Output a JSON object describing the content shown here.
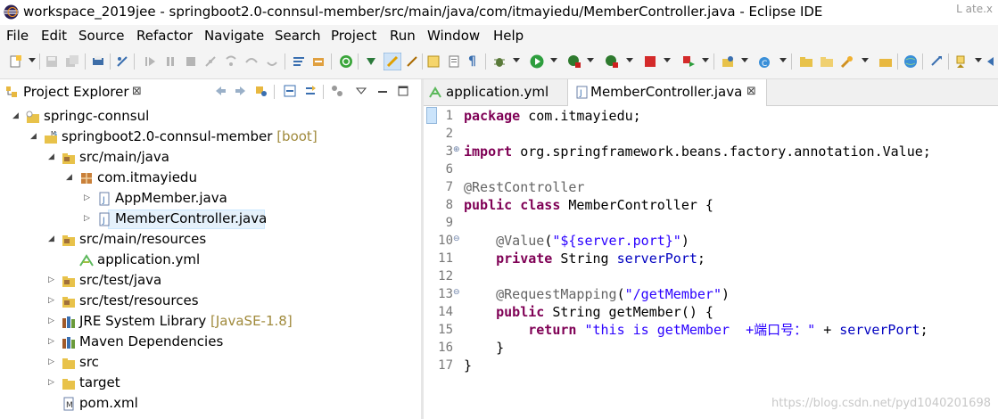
{
  "window": {
    "title": "workspace_2019jee - springboot2.0-connsul-member/src/main/java/com/itmayiedu/MemberController.java - Eclipse IDE",
    "behind_text": "L ate.x"
  },
  "menubar": {
    "items": [
      "File",
      "Edit",
      "Source",
      "Refactor",
      "Navigate",
      "Search",
      "Project",
      "Run",
      "Window",
      "Help"
    ]
  },
  "toolbar": {
    "icons": [
      "new-icon",
      "save-icon",
      "save-all-icon",
      "print-icon",
      "toggle-breakpoint-icon",
      "resume-icon",
      "suspend-icon",
      "terminate-icon",
      "disconnect-icon",
      "step-into-icon",
      "step-over-icon",
      "step-return-icon",
      "drop-to-frame-icon",
      "use-step-filters-icon",
      "spring-icon",
      "open-task-icon",
      "mark-occurrences-icon",
      "toggle-block-icon",
      "toggle-whitespace-icon",
      "skip-breakpoints-icon",
      "debug-icon",
      "run-icon",
      "coverage-icon",
      "external-tools-icon",
      "stop-icon",
      "deploy-icon",
      "new-java-project-icon",
      "new-class-icon",
      "open-type-icon",
      "open-task-icon-2",
      "search-icon",
      "globe-icon",
      "next-annotation-icon",
      "back-icon"
    ]
  },
  "explorer": {
    "title": "Project Explorer",
    "tree": [
      {
        "label": "springc-connsul",
        "decoration": "",
        "icon": "project-icon",
        "twisty": "expanded",
        "depth": 0,
        "selected": false
      },
      {
        "label": "springboot2.0-connsul-member",
        "decoration": " [boot]",
        "icon": "maven-project-icon",
        "twisty": "expanded",
        "depth": 1,
        "selected": false
      },
      {
        "label": "src/main/java",
        "decoration": "",
        "icon": "source-folder-icon",
        "twisty": "expanded",
        "depth": 2,
        "selected": false
      },
      {
        "label": "com.itmayiedu",
        "decoration": "",
        "icon": "package-icon",
        "twisty": "expanded",
        "depth": 3,
        "selected": false
      },
      {
        "label": "AppMember.java",
        "decoration": "",
        "icon": "java-file-icon",
        "twisty": "collapsed",
        "depth": 4,
        "selected": false
      },
      {
        "label": "MemberController.java",
        "decoration": "",
        "icon": "java-file-icon",
        "twisty": "collapsed",
        "depth": 4,
        "selected": true
      },
      {
        "label": "src/main/resources",
        "decoration": "",
        "icon": "source-folder-icon",
        "twisty": "expanded",
        "depth": 2,
        "selected": false
      },
      {
        "label": "application.yml",
        "decoration": "",
        "icon": "yml-file-icon",
        "twisty": "none",
        "depth": 3,
        "selected": false
      },
      {
        "label": "src/test/java",
        "decoration": "",
        "icon": "source-folder-icon",
        "twisty": "collapsed",
        "depth": 2,
        "selected": false
      },
      {
        "label": "src/test/resources",
        "decoration": "",
        "icon": "source-folder-icon",
        "twisty": "collapsed",
        "depth": 2,
        "selected": false
      },
      {
        "label": "JRE System Library",
        "decoration": " [JavaSE-1.8]",
        "icon": "library-icon",
        "twisty": "collapsed",
        "depth": 2,
        "selected": false
      },
      {
        "label": "Maven Dependencies",
        "decoration": "",
        "icon": "library-icon",
        "twisty": "collapsed",
        "depth": 2,
        "selected": false
      },
      {
        "label": "src",
        "decoration": "",
        "icon": "folder-icon",
        "twisty": "collapsed",
        "depth": 2,
        "selected": false
      },
      {
        "label": "target",
        "decoration": "",
        "icon": "folder-icon",
        "twisty": "collapsed",
        "depth": 2,
        "selected": false
      },
      {
        "label": "pom.xml",
        "decoration": "",
        "icon": "xml-file-icon",
        "twisty": "none",
        "depth": 2,
        "selected": false
      }
    ]
  },
  "editor": {
    "tabs": [
      {
        "label": "application.yml",
        "active": false,
        "icon": "yml-file-icon"
      },
      {
        "label": "MemberController.java",
        "active": true,
        "icon": "java-file-icon"
      }
    ],
    "lines": [
      {
        "no": "1",
        "fold": "",
        "tokens": [
          [
            "kw",
            "package"
          ],
          [
            "",
            "com.itmayiedu;"
          ]
        ]
      },
      {
        "no": "2",
        "fold": "",
        "tokens": []
      },
      {
        "no": "3",
        "fold": "+",
        "tokens": [
          [
            "kw",
            "import"
          ],
          [
            "",
            "org.springframework.beans.factory.annotation.Value;"
          ]
        ]
      },
      {
        "no": "6",
        "fold": "",
        "tokens": []
      },
      {
        "no": "7",
        "fold": "",
        "tokens": [
          [
            "an",
            "@RestController"
          ]
        ]
      },
      {
        "no": "8",
        "fold": "",
        "tokens": [
          [
            "kw",
            "public"
          ],
          [
            "kw",
            "class"
          ],
          [
            "",
            "MemberController {"
          ]
        ]
      },
      {
        "no": "9",
        "fold": "",
        "tokens": []
      },
      {
        "no": "10",
        "fold": "-",
        "tokens": [
          [
            "sp",
            "    "
          ],
          [
            "an",
            "@Value"
          ],
          [
            "",
            "("
          ],
          [
            "st",
            "\"${server.port}\""
          ],
          [
            "",
            ")"
          ]
        ]
      },
      {
        "no": "11",
        "fold": "",
        "tokens": [
          [
            "sp",
            "    "
          ],
          [
            "kw",
            "private"
          ],
          [
            "",
            "String"
          ],
          [
            "fd",
            "serverPort"
          ],
          [
            "",
            ";"
          ]
        ]
      },
      {
        "no": "12",
        "fold": "",
        "tokens": []
      },
      {
        "no": "13",
        "fold": "-",
        "tokens": [
          [
            "sp",
            "    "
          ],
          [
            "an",
            "@RequestMapping"
          ],
          [
            "",
            "("
          ],
          [
            "st",
            "\"/getMember\""
          ],
          [
            "",
            ")"
          ]
        ]
      },
      {
        "no": "14",
        "fold": "",
        "tokens": [
          [
            "sp",
            "    "
          ],
          [
            "kw",
            "public"
          ],
          [
            "",
            "String getMember() {"
          ]
        ]
      },
      {
        "no": "15",
        "fold": "",
        "tokens": [
          [
            "sp",
            "        "
          ],
          [
            "kw",
            "return"
          ],
          [
            "st",
            "\"this is getMember  +端口号：\""
          ],
          [
            "",
            "+"
          ],
          [
            "fd",
            "serverPort"
          ],
          [
            "",
            ";"
          ]
        ]
      },
      {
        "no": "16",
        "fold": "",
        "tokens": [
          [
            "sp",
            "    "
          ],
          [
            "",
            "}"
          ]
        ]
      },
      {
        "no": "17",
        "fold": "",
        "tokens": [
          [
            "",
            "}"
          ]
        ]
      }
    ]
  },
  "watermark": "https://blog.csdn.net/pyd1040201698"
}
